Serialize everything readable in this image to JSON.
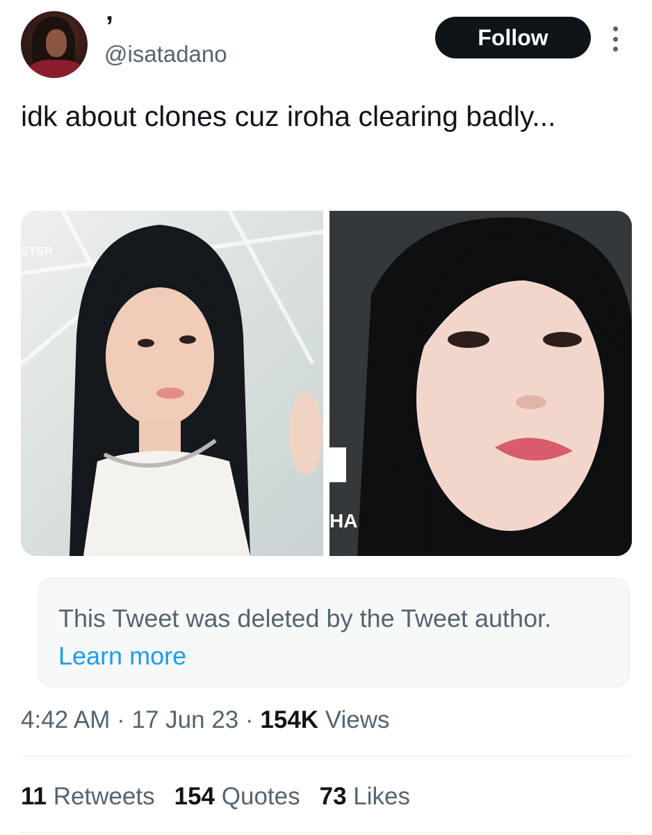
{
  "author": {
    "display_name": "’",
    "handle": "@isatadano"
  },
  "follow_button": {
    "label": "Follow"
  },
  "tweet": {
    "text": "idk about clones cuz iroha clearing badly...",
    "images": [
      {
        "overlay_text": "STER"
      },
      {
        "overlay_text": "HA"
      }
    ]
  },
  "quoted": {
    "message": "This Tweet was deleted by the Tweet author.",
    "link": "Learn more"
  },
  "meta": {
    "time": "4:42 AM",
    "sep1": " · ",
    "date": "17 Jun 23",
    "sep2": " · ",
    "views_count": "154K",
    "views_label": " Views"
  },
  "stats": {
    "retweets": {
      "count": "11",
      "label": " Retweets"
    },
    "quotes": {
      "count": "154",
      "label": " Quotes"
    },
    "likes": {
      "count": "73",
      "label": " Likes"
    }
  },
  "colors": {
    "secondary_text": "#536471",
    "link": "#1d9bf0",
    "button_bg": "#0f1419"
  },
  "icons": {
    "more": "more-dots-vertical-icon"
  }
}
